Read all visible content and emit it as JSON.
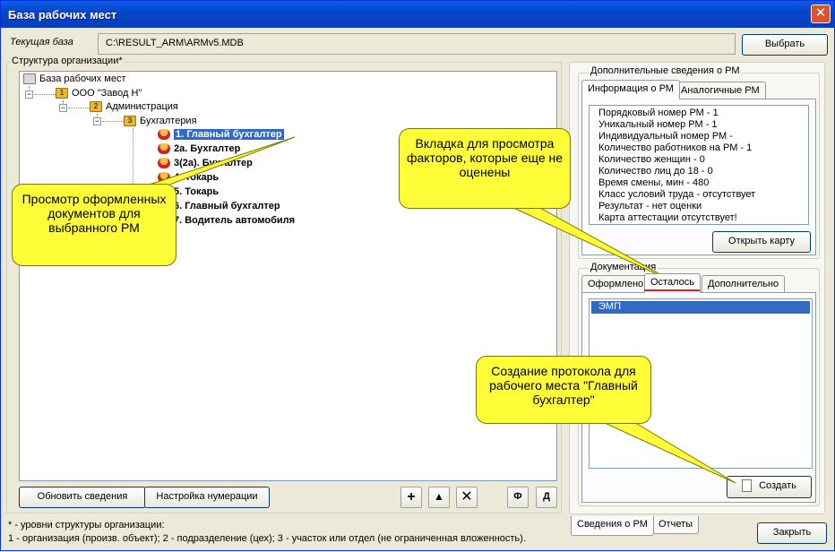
{
  "window": {
    "title": "База рабочих мест",
    "close_glyph": "✕"
  },
  "db": {
    "label": "Текущая база",
    "path": "C:\\RESULT_ARM\\ARMv5.MDB",
    "select_button": "Выбрать"
  },
  "structure": {
    "title": "Структура организации*",
    "root": "База рабочих мест",
    "org": "ООО \"Завод Н\"",
    "subdivision": "Администрация",
    "department": "Бухгалтерия",
    "workplaces": [
      "1. Главный бухгалтер",
      "2а. Бухгалтер",
      "3(2а). Бухгалтер",
      "4. Токарь",
      "5. Токарь",
      "6. Главный бухгалтер",
      "7. Водитель автомобиля"
    ],
    "level_badges": [
      "1",
      "2",
      "3"
    ],
    "buttons": {
      "refresh": "Обновить сведения",
      "numbering": "Настройка нумерации",
      "add": "+",
      "up": "▲",
      "delete": "✕",
      "f": "Ф",
      "d": "Д"
    }
  },
  "footnote": {
    "line1": "* - уровни структуры организации:",
    "line2": "1 - организация (произв. объект); 2 - подразделение (цех); 3 - участок или отдел (не ограниченная вложенность)."
  },
  "extra": {
    "title": "Дополнительные сведения о РМ",
    "tabs": [
      "Информация о РМ",
      "Аналогичные РМ"
    ],
    "info": [
      "Порядковый номер РМ - 1",
      "Уникальный номер РМ - 1",
      "Индивидуальный номер РМ -",
      "Количество работников на РМ - 1",
      "Количество женщин - 0",
      "Количество лиц до 18 - 0",
      "Время смены, мин - 480",
      "Класс условий труда - отсутствует",
      "Результат - нет оценки",
      "Карта аттестации отсутствует!"
    ],
    "open_card": "Открыть карту"
  },
  "docs": {
    "title": "Документация",
    "tabs": [
      "Оформлено",
      "Осталось",
      "Дополнительно"
    ],
    "items": [
      "ЭМП"
    ],
    "create": "Создать"
  },
  "bottom_tabs": [
    "Сведения о РМ",
    "Отчеты"
  ],
  "close_button": "Закрыть",
  "callouts": {
    "docs_view": "Просмотр оформленных документов для выбранного РМ",
    "tab_remaining": "Вкладка для просмотра факторов, которые еще не оценены",
    "create_protocol": "Создание протокола для рабочего места \"Главный бухгалтер\""
  },
  "colors": {
    "selection": "#316ac5",
    "callout": "#fffd38",
    "underline": "#e02020"
  }
}
